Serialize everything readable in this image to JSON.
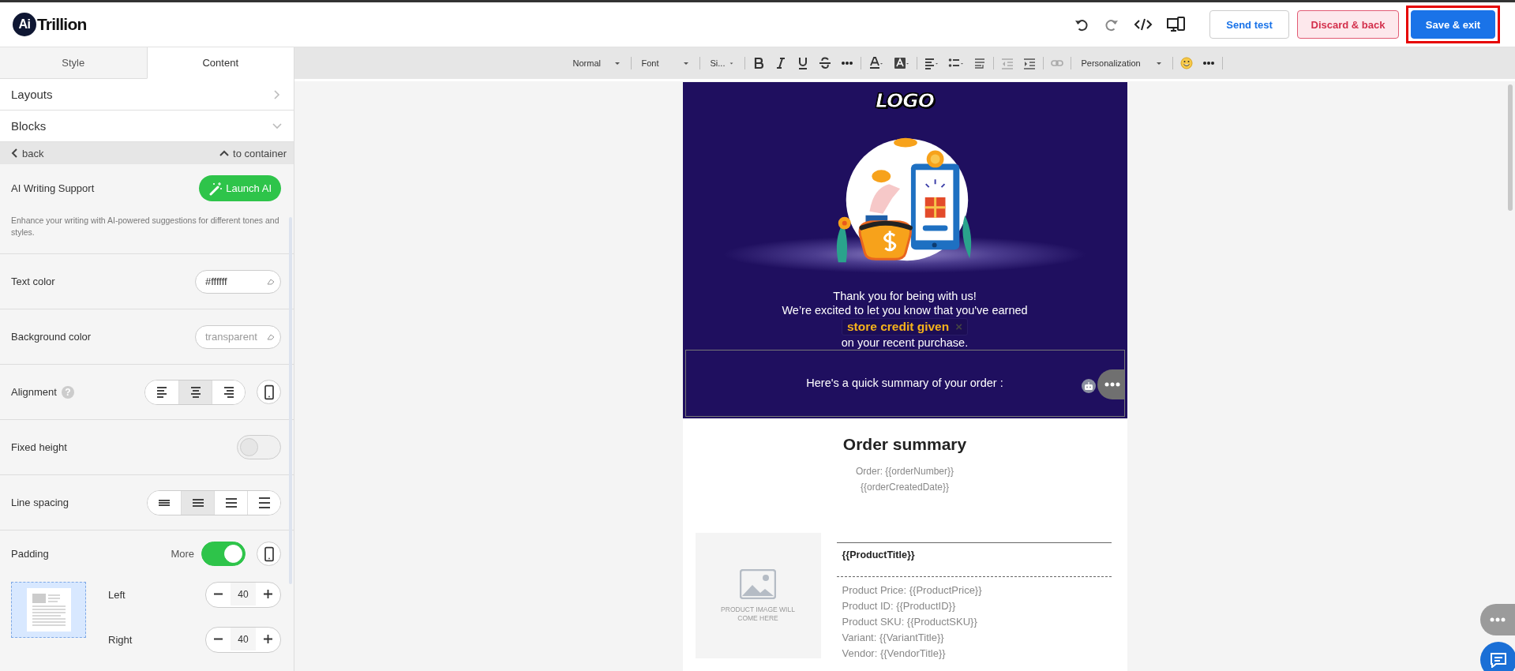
{
  "header": {
    "logo_mark": "Ai",
    "logo_text": "Trillion",
    "buttons": [
      {
        "label": "Send test",
        "kind": "outline",
        "highlighted": false
      },
      {
        "label": "Discard & back",
        "kind": "danger",
        "highlighted": false
      },
      {
        "label": "Save & exit",
        "kind": "primary",
        "highlighted": true
      }
    ]
  },
  "sidebar": {
    "tabs": [
      {
        "label": "Style",
        "selected": false
      },
      {
        "label": "Content",
        "selected": true
      }
    ],
    "sections": [
      {
        "label": "Layouts",
        "expanded": false
      },
      {
        "label": "Blocks",
        "expanded": true
      }
    ],
    "back": "back",
    "to_container": "to container",
    "settings": [
      {
        "kind": "ai",
        "label": "AI Writing Support",
        "button": "Launch AI",
        "description": "Enhance your writing with AI-powered suggestions for different tones and styles."
      },
      {
        "kind": "color",
        "label": "Text color",
        "value": "#ffffff"
      },
      {
        "kind": "color",
        "label": "Background color",
        "placeholder": "transparent"
      },
      {
        "kind": "alignment",
        "label": "Alignment",
        "help": "?",
        "options": [
          {
            "selected": false
          },
          {
            "selected": true
          },
          {
            "selected": false
          }
        ]
      },
      {
        "kind": "toggle",
        "label": "Fixed height",
        "on": false
      },
      {
        "kind": "spacing",
        "label": "Line spacing",
        "options": [
          {
            "selected": false
          },
          {
            "selected": true
          },
          {
            "selected": false
          },
          {
            "selected": false
          }
        ]
      },
      {
        "kind": "padding",
        "label": "Padding",
        "more": "More",
        "on": true,
        "sides": [
          {
            "label": "Left",
            "value": "40"
          },
          {
            "label": "Right",
            "value": "40"
          }
        ]
      }
    ]
  },
  "toolbar": {
    "dropdowns": [
      "Normal",
      "Font",
      "Si..."
    ],
    "personalization": "Personalization"
  },
  "email": {
    "logo": "LOGO",
    "message": [
      "Thank you for being with us!",
      "We’re excited to let you know that you've earned"
    ],
    "merge_tag": "store credit given",
    "merge_tag_remove": "×",
    "message_end": "on your recent purchase.",
    "summary_intro": "Here's a quick summary of your order :",
    "order_title": "Order summary",
    "order_lines": [
      "Order: {{orderNumber}}",
      "{{orderCreatedDate}}"
    ],
    "image_placeholder": "PRODUCT IMAGE WILL COME HERE",
    "product_title": "{{ProductTitle}}",
    "product_details": [
      "Product Price: {{ProductPrice}}",
      "Product ID: {{ProductID}}",
      "Product SKU: {{ProductSKU}}",
      "Variant: {{VariantTitle}}",
      "Vendor: {{VendorTitle}}"
    ]
  }
}
